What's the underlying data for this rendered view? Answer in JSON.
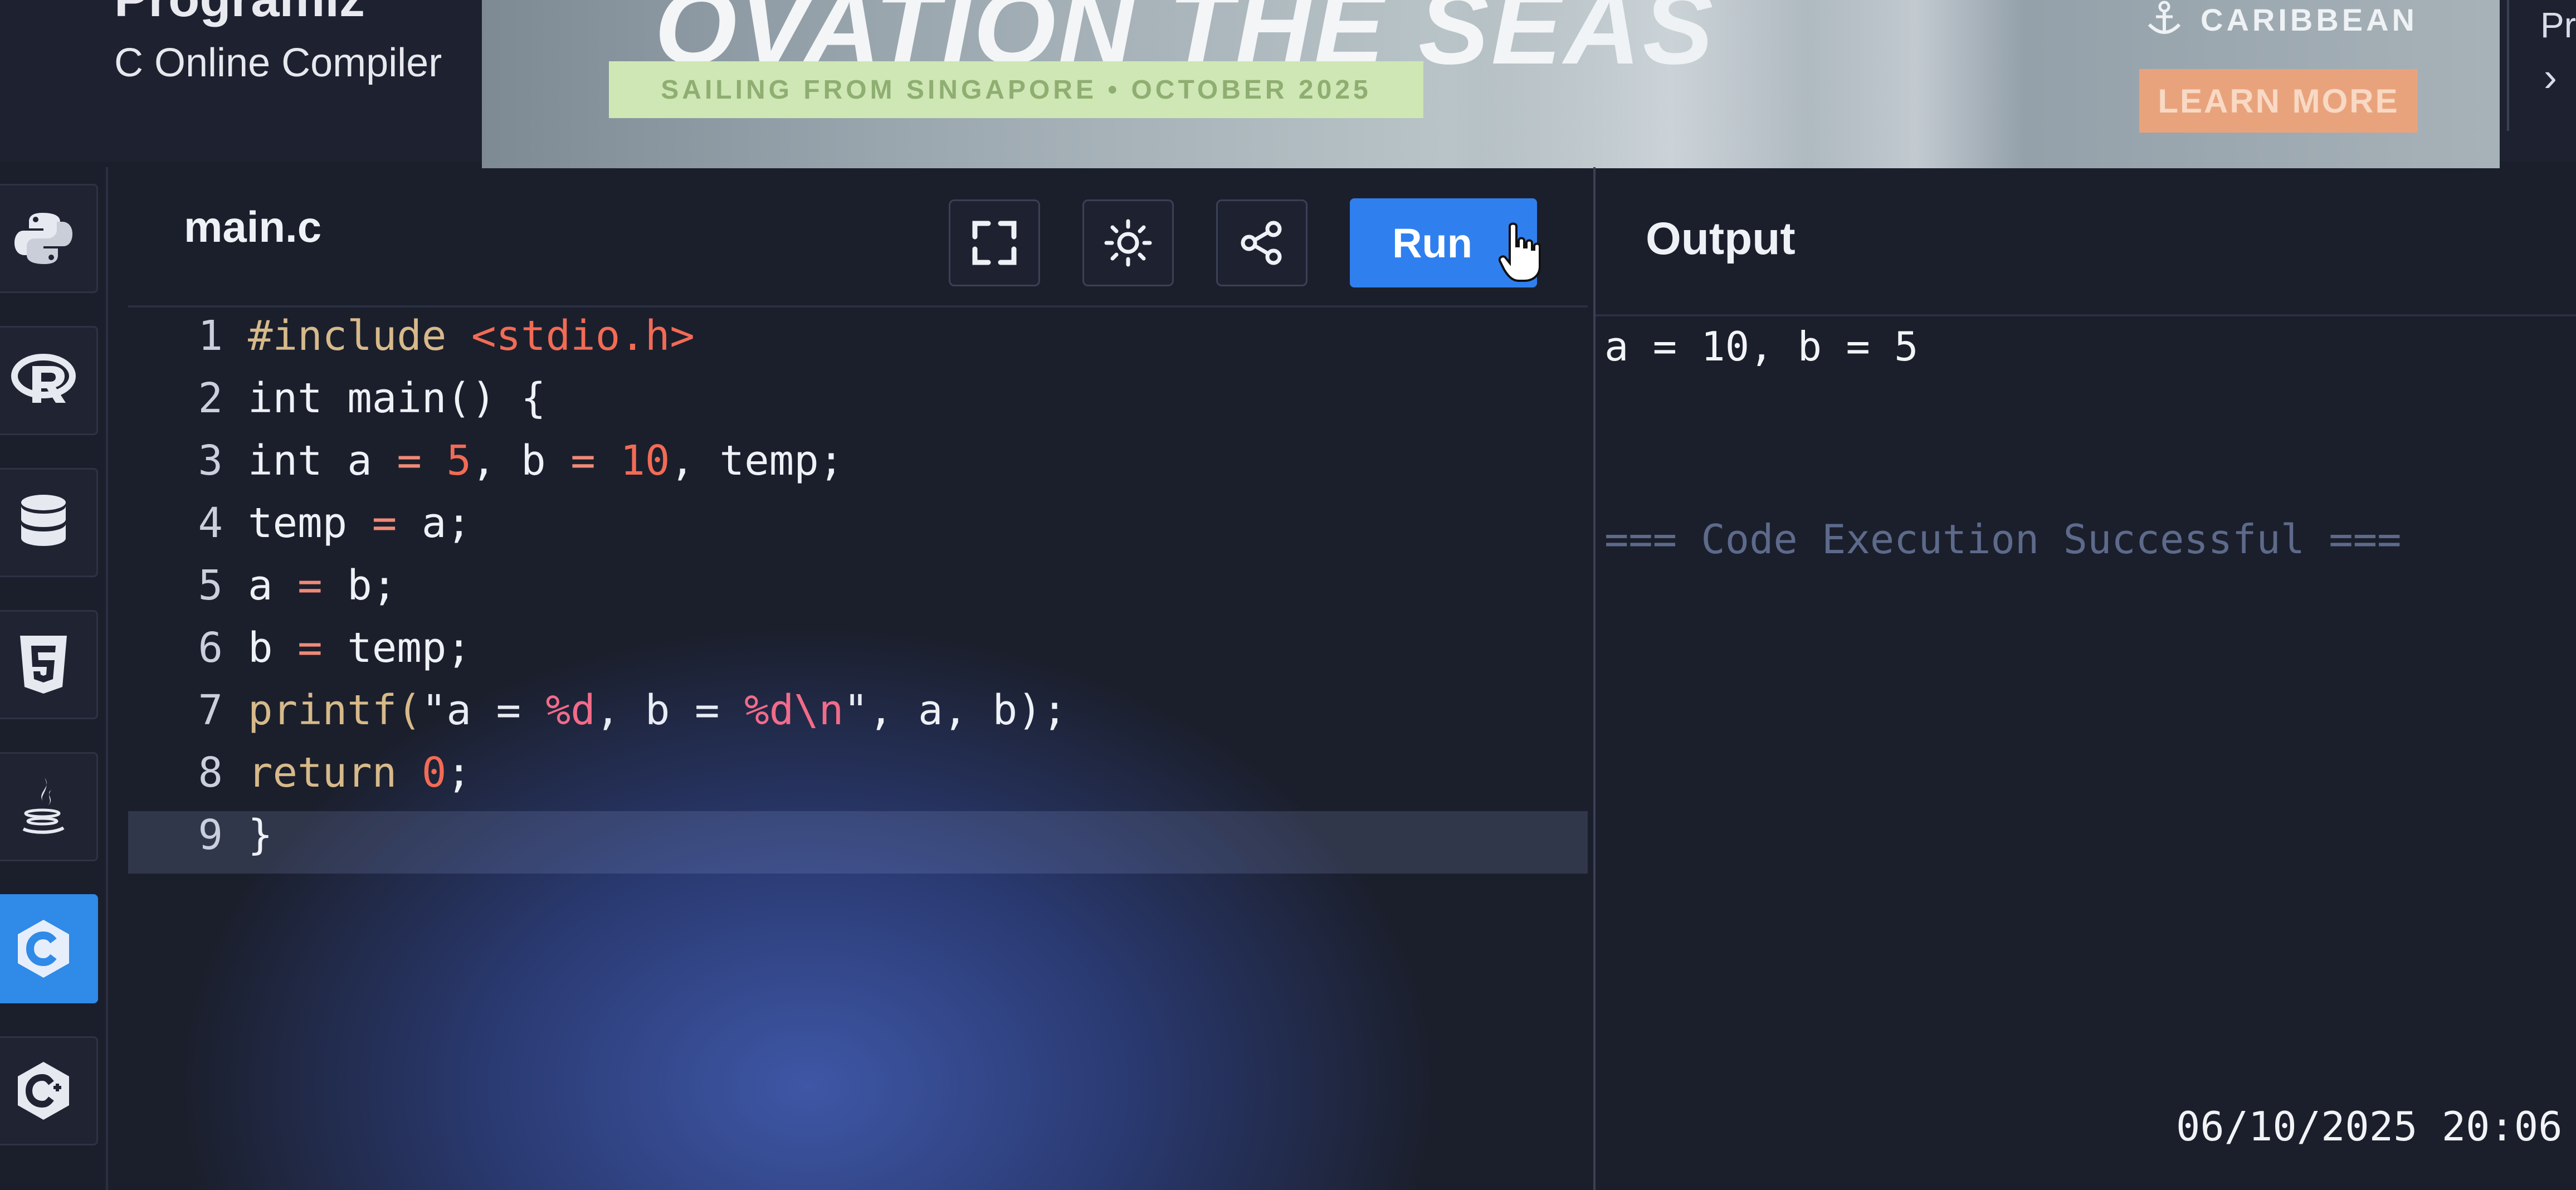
{
  "header": {
    "brand_title": "Programiz",
    "subtitle": "C Online Compiler"
  },
  "ad": {
    "headline": "OVATION THE SEAS",
    "tagline": "SAILING FROM SINGAPORE • OCTOBER 2025",
    "brand": "CARIBBEAN",
    "cta": "LEARN MORE",
    "next_label": "Pr",
    "next_icon": "›",
    "colors": {
      "strip": "#cfe7b4",
      "cta": "#e9a37c"
    }
  },
  "sidebar": {
    "items": [
      {
        "name": "Python",
        "icon": "python-icon",
        "active": false
      },
      {
        "name": "R",
        "icon": "r-icon",
        "active": false
      },
      {
        "name": "SQL",
        "icon": "database-icon",
        "active": false
      },
      {
        "name": "HTML",
        "icon": "html5-icon",
        "active": false
      },
      {
        "name": "Java",
        "icon": "java-icon",
        "active": false
      },
      {
        "name": "C",
        "icon": "c-icon",
        "active": true
      },
      {
        "name": "C++",
        "icon": "cpp-icon",
        "active": false
      }
    ],
    "accent": "#2f8ae8"
  },
  "editor": {
    "filename": "main.c",
    "toolbar": {
      "fullscreen_icon": "fullscreen-icon",
      "theme_icon": "sun-icon",
      "share_icon": "share-icon",
      "run_label": "Run"
    },
    "lines": [
      {
        "n": "1",
        "tokens": [
          {
            "t": "#include ",
            "c": "#d7b98a"
          },
          {
            "t": "<stdio.h>",
            "c": "#f26b55"
          }
        ]
      },
      {
        "n": "2",
        "tokens": [
          {
            "t": "int main() {",
            "c": "#eef1f6"
          }
        ]
      },
      {
        "n": "3",
        "tokens": [
          {
            "t": "int a ",
            "c": "#eef1f6"
          },
          {
            "t": "=",
            "c": "#f08a78"
          },
          {
            "t": " ",
            "c": "#eef1f6"
          },
          {
            "t": "5",
            "c": "#f26b55"
          },
          {
            "t": ", b ",
            "c": "#eef1f6"
          },
          {
            "t": "=",
            "c": "#f08a78"
          },
          {
            "t": " ",
            "c": "#eef1f6"
          },
          {
            "t": "10",
            "c": "#f26b55"
          },
          {
            "t": ", temp;",
            "c": "#eef1f6"
          }
        ]
      },
      {
        "n": "4",
        "tokens": [
          {
            "t": "temp ",
            "c": "#eef1f6"
          },
          {
            "t": "=",
            "c": "#f08a78"
          },
          {
            "t": " a;",
            "c": "#eef1f6"
          }
        ]
      },
      {
        "n": "5",
        "tokens": [
          {
            "t": "a ",
            "c": "#eef1f6"
          },
          {
            "t": "=",
            "c": "#f08a78"
          },
          {
            "t": " b;",
            "c": "#eef1f6"
          }
        ]
      },
      {
        "n": "6",
        "tokens": [
          {
            "t": "b ",
            "c": "#eef1f6"
          },
          {
            "t": "=",
            "c": "#f08a78"
          },
          {
            "t": " temp;",
            "c": "#eef1f6"
          }
        ]
      },
      {
        "n": "7",
        "tokens": [
          {
            "t": "printf(",
            "c": "#d7b98a"
          },
          {
            "t": "\"a = ",
            "c": "#e8ecf4"
          },
          {
            "t": "%d",
            "c": "#f26b8a"
          },
          {
            "t": ", b = ",
            "c": "#e8ecf4"
          },
          {
            "t": "%d\\n",
            "c": "#f26b8a"
          },
          {
            "t": "\"",
            "c": "#e8ecf4"
          },
          {
            "t": ", a, b);",
            "c": "#eef1f6"
          }
        ]
      },
      {
        "n": "8",
        "tokens": [
          {
            "t": "return ",
            "c": "#d7b98a"
          },
          {
            "t": "0",
            "c": "#f26b55"
          },
          {
            "t": ";",
            "c": "#eef1f6"
          }
        ]
      },
      {
        "n": "9",
        "tokens": [
          {
            "t": "}",
            "c": "#eef1f6"
          }
        ]
      }
    ],
    "current_line": 9
  },
  "output": {
    "title": "Output",
    "lines": [
      {
        "text": "a = 10, b = 5",
        "color": "#f2f4f8"
      },
      {
        "text": "=== Code Execution Successful ===",
        "color": "#5d6a8a"
      }
    ]
  },
  "timestamp": "06/10/2025 20:06"
}
